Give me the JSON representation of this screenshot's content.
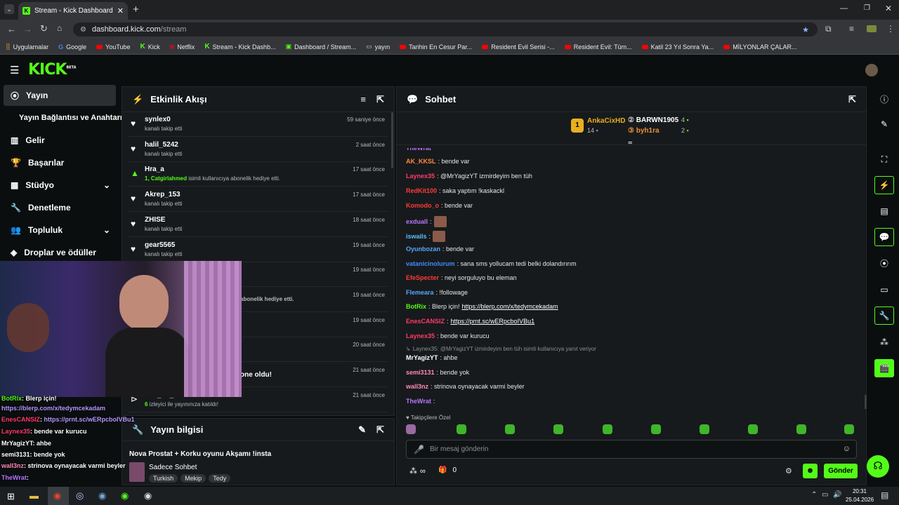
{
  "browser": {
    "tab_title": "Stream - Kick Dashboard",
    "url_host": "dashboard.kick.com",
    "url_path": "/stream",
    "bookmarks": [
      "Uygulamalar",
      "Google",
      "YouTube",
      "Kick",
      "Netflix",
      "Stream - Kick Dashb...",
      "Dashboard / Stream...",
      "yayın",
      "Tarihin En Cesur Par...",
      "Resident Evil Serisi -...",
      "Resident Evil: Tüm...",
      "Katil 23 Yıl Sonra Ya...",
      "MİLYONLAR ÇALAR..."
    ]
  },
  "header": {
    "logo": "KICK",
    "logo_sup": "BETA"
  },
  "sidebar": {
    "items": [
      "Yayın",
      "Yayın Bağlantısı ve Anahtarı",
      "Gelir",
      "Başarılar",
      "Stüdyo",
      "Denetleme",
      "Topluluk",
      "Droplar ve ödüller"
    ]
  },
  "activity": {
    "title": "Etkinlik Akışı",
    "events": [
      {
        "name": "synlex0",
        "sub": "kanalı takip etti",
        "time": "59 saniye önce"
      },
      {
        "name": "halil_5242",
        "sub": "kanalı takip etti",
        "time": "2 saat önce"
      },
      {
        "name": "Hra_a",
        "sub_user": "1, Catgirlahmed",
        "sub": " isimli kullanıcıya abonelik hediye etti.",
        "time": "17 saat önce"
      },
      {
        "name": "Akrep_153",
        "sub": "kanalı takip etti",
        "time": "17 saat önce"
      },
      {
        "name": "ZHISE",
        "sub": "kanalı takip etti",
        "time": "18 saat önce"
      },
      {
        "name": "gear5565",
        "sub": "kanalı takip etti",
        "time": "19 saat önce"
      },
      {
        "time": "19 saat önce"
      },
      {
        "sub": "abonelik hediye etti.",
        "time": "19 saat önce"
      },
      {
        "time": "19 saat önce"
      },
      {
        "time": "20 saat önce"
      },
      {
        "sub": "one oldu!",
        "time": "21 saat önce"
      },
      {
        "name": "stat_on_fire",
        "sub_user": "6",
        "sub": " izleyici ile yayınınıza katıldı!",
        "time": "21 saat önce"
      }
    ]
  },
  "stream_info": {
    "title": "Yayın bilgisi",
    "stream_title": "Nova Prostat + Korku oyunu Akşamı !insta",
    "category": "Sadece Sohbet",
    "tags": [
      "Turkish",
      "Mekip",
      "Tedy"
    ]
  },
  "chat": {
    "title": "Sohbet",
    "leaders": [
      {
        "name": "AnkaCixHD",
        "count": "14"
      },
      {
        "name": "BARWN1905",
        "count": "4"
      },
      {
        "name": "byh1ra",
        "count": "2"
      }
    ],
    "messages": [
      {
        "user": "TheWrat",
        "text": "",
        "color": "#b676ff"
      },
      {
        "user": "AK_KKSL",
        "text": ": bende var",
        "color": "#ff8a3d"
      },
      {
        "user": "Laynex35",
        "text": ": @MrYagizYT izmirdeyim ben tüh",
        "color": "#ff3b6b"
      },
      {
        "user": "RedKit100",
        "text": ": saka yaptım !kaskackl",
        "color": "#ff3b3b"
      },
      {
        "user": "Komodo_o",
        "text": ": bende var",
        "color": "#ff3b3b"
      },
      {
        "user": "exdualI",
        "text": ":",
        "color": "#b676ff"
      },
      {
        "user": "iswails",
        "text": ":",
        "color": "#58c1ff"
      },
      {
        "user": "Oyunbozan",
        "text": ": bende var",
        "color": "#58a6ff"
      },
      {
        "user": "vatanicinolurum",
        "text": ": sana sms yollucam tedi belki dolandırırım",
        "color": "#3d8bff"
      },
      {
        "user": "EfeSpecter",
        "text": ": neyi sorguluyo bu eleman",
        "color": "#ff3b3b"
      },
      {
        "user": "Flemeara",
        "text": ": !followage",
        "color": "#58a6ff"
      },
      {
        "user": "BotRix",
        "text": ": Blerp için! ",
        "link": "https://blerp.com/x/tedymcekadam",
        "color": "#53fc18"
      },
      {
        "user": "EnesCANSIZ",
        "text": ": ",
        "link": "https://prnt.sc/wERpcboIVBu1",
        "color": "#ff3b6b"
      },
      {
        "user": "Laynex35",
        "text": ": bende var kurucu",
        "color": "#ff3b6b"
      },
      {
        "reply": "Laynex35: @MrYagizYT izmirdeyim ben tüh isimli kullanıcıya yanıt veriyor"
      },
      {
        "user": "MrYagizYT",
        "text": ": ahbe",
        "color": "#ffffff"
      },
      {
        "user": "semi3131",
        "text": ": bende yok",
        "color": "#ff8ab6"
      },
      {
        "user": "wall3nz",
        "text": ": strinova oynayacak varmi beyler",
        "color": "#ff8ab6"
      },
      {
        "user": "TheWrat",
        "text": ":",
        "color": "#b676ff"
      }
    ],
    "subscribers_label": "Takipçilere Özel",
    "input_placeholder": "Bir mesaj gönderin",
    "points": "∞",
    "gifts": "0",
    "send_label": "Gönder"
  },
  "overlay_chat": [
    {
      "user": "BotRix",
      "text": ": Blerp için!",
      "color": "#53fc18"
    },
    {
      "link": "https://blerp.com/x/tedymcekadam"
    },
    {
      "user": "EnesCANSIZ",
      "text": ": ",
      "link": "https://prnt.sc/wERpcboIVBu1",
      "color": "#ff3b6b"
    },
    {
      "user": "Laynex35",
      "text": ": bende var kurucu",
      "color": "#ff3b6b"
    },
    {
      "user": "MrYagizYT",
      "text": ": ahbe",
      "color": "#ffffff"
    },
    {
      "user": "semi3131",
      "text": ": bende yok",
      "color": "#ffffff"
    },
    {
      "user": "wall3nz",
      "text": ": strinova oynayacak varmi beyler",
      "color": "#ff8ab6"
    },
    {
      "user": "TheWrat",
      "text": ":",
      "color": "#b676ff"
    }
  ],
  "taskbar": {
    "time": "20:31",
    "date": "25.04.2026"
  },
  "colors": {
    "accent": "#53fc18",
    "bg": "#0b0e0f",
    "panel": "#171a1c"
  }
}
